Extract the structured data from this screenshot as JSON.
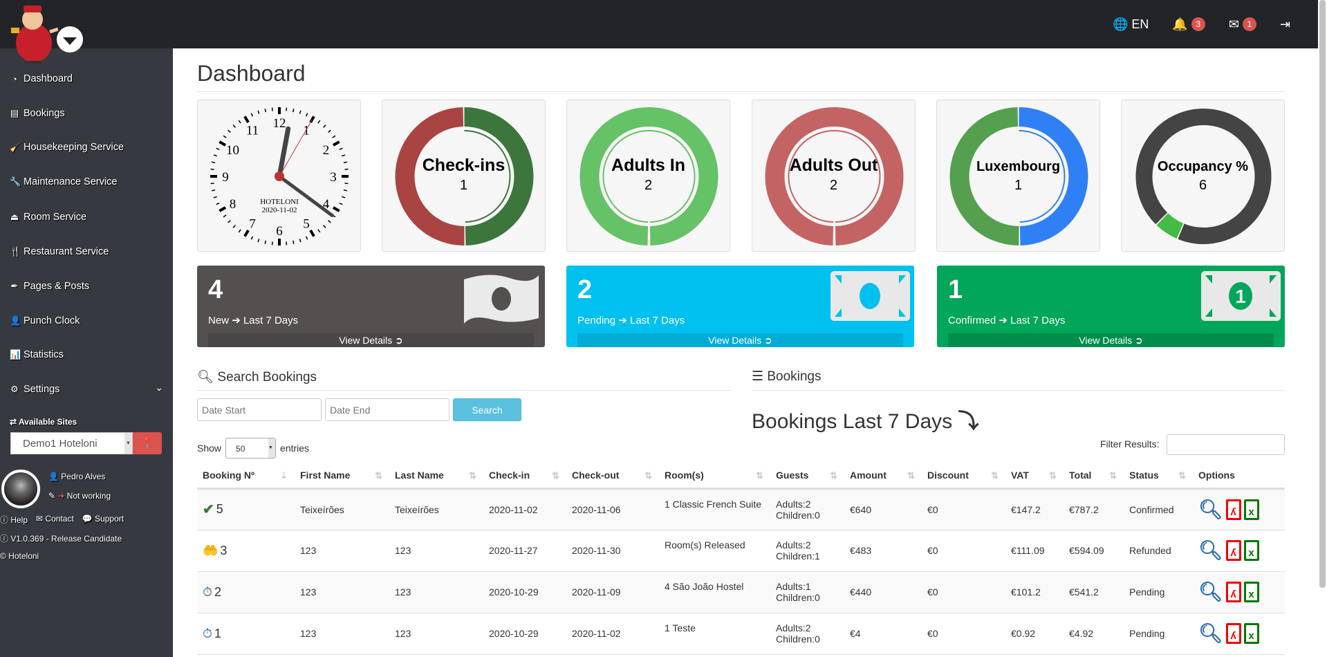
{
  "topbar": {
    "language": "EN",
    "notifications_count": "3",
    "messages_count": "1",
    "icons": [
      "globe-icon",
      "bell-icon",
      "envelope-icon",
      "sign-out-icon"
    ]
  },
  "sidebar": {
    "items": [
      {
        "label": "Dashboard",
        "icon": "dashboard-icon"
      },
      {
        "label": "Bookings",
        "icon": "list-alt-icon"
      },
      {
        "label": "Housekeeping Service",
        "icon": "broom-icon"
      },
      {
        "label": "Maintenance Service",
        "icon": "wrench-icon"
      },
      {
        "label": "Room Service",
        "icon": "bell-concierge-icon"
      },
      {
        "label": "Restaurant Service",
        "icon": "cutlery-icon"
      },
      {
        "label": "Pages & Posts",
        "icon": "pen-nib-icon"
      },
      {
        "label": "Punch Clock",
        "icon": "user-clock-icon"
      },
      {
        "label": "Statistics",
        "icon": "bar-chart-icon"
      },
      {
        "label": "Settings",
        "icon": "gear-icon"
      }
    ],
    "sites_label": "Available Sites",
    "site_selected": "Demo1 Hoteloni",
    "user_name": "Pedro Alves",
    "user_status": "Not working",
    "links": [
      "Help",
      "Contact",
      "Support"
    ],
    "version": "V1.0.369 - Release Candidate",
    "brand": "Hoteloni"
  },
  "page_title": "Dashboard",
  "clock": {
    "brand": "HOTELONI",
    "date": "2020-11-02",
    "time": "12:21:05"
  },
  "donuts": [
    {
      "label": "Check-ins",
      "value": "1",
      "segments": [
        {
          "color": "#3c763d",
          "share": 0.5
        },
        {
          "color": "#a94442",
          "share": 0.5
        }
      ]
    },
    {
      "label": "Adults In",
      "value": "2",
      "segments": [
        {
          "color": "#66c266",
          "share": 1
        }
      ]
    },
    {
      "label": "Adults Out",
      "value": "2",
      "segments": [
        {
          "color": "#c46363",
          "share": 1
        }
      ]
    },
    {
      "label": "Luxembourg",
      "value": "1",
      "segments": [
        {
          "color": "#2f80f5",
          "share": 0.5
        },
        {
          "color": "#55a04f",
          "share": 0.5
        }
      ]
    },
    {
      "label": "Occupancy %",
      "value": "6",
      "segments": [
        {
          "color": "#444444",
          "share": 0.94
        },
        {
          "color": "#44bb44",
          "share": 0.06
        }
      ]
    }
  ],
  "panels": [
    {
      "count": "4",
      "status": "New",
      "period": "Last 7 Days",
      "link": "View Details",
      "color": "#545050",
      "bar": "#4a4646"
    },
    {
      "count": "2",
      "status": "Pending",
      "period": "Last 7 Days",
      "link": "View Details",
      "color": "#00c0ef",
      "bar": "#00acd6"
    },
    {
      "count": "1",
      "status": "Confirmed",
      "period": "Last 7 Days",
      "link": "View Details",
      "color": "#00a65a",
      "bar": "#008d4c"
    }
  ],
  "search": {
    "title": "Search Bookings",
    "date_start_placeholder": "Date Start",
    "date_end_placeholder": "Date End",
    "button": "Search"
  },
  "bookings": {
    "title": "Bookings",
    "subtitle": "Bookings Last 7 Days",
    "show_label": "Show",
    "entries_label": "entries",
    "page_size": "50",
    "filter_label": "Filter Results:"
  },
  "table": {
    "columns": [
      "Booking Nº",
      "First Name",
      "Last Name",
      "Check-in",
      "Check-out",
      "Room(s)",
      "Guests",
      "Amount",
      "Discount",
      "VAT",
      "Total",
      "Status",
      "Options"
    ],
    "rows": [
      {
        "icon": "check-icon",
        "no": "5",
        "first": "Teixeírões",
        "last": "Teixeírões",
        "checkin": "2020-11-02",
        "checkout": "2020-11-06",
        "rooms": "1 Classic French Suite",
        "adults": "Adults:2",
        "children": "Children:0",
        "amount": "€640",
        "discount": "€0",
        "vat": "€147.2",
        "total": "€787.2",
        "status": "Confirmed"
      },
      {
        "icon": "refund-hand-icon",
        "no": "3",
        "first": "123",
        "last": "123",
        "checkin": "2020-11-27",
        "checkout": "2020-11-30",
        "rooms": "Room(s) Released",
        "adults": "Adults:2",
        "children": "Children:1",
        "amount": "€483",
        "discount": "€0",
        "vat": "€111.09",
        "total": "€594.09",
        "status": "Refunded"
      },
      {
        "icon": "stopwatch-icon",
        "no": "2",
        "first": "123",
        "last": "123",
        "checkin": "2020-10-29",
        "checkout": "2020-11-09",
        "rooms": "4 São João Hostel",
        "adults": "Adults:1",
        "children": "Children:0",
        "amount": "€440",
        "discount": "€0",
        "vat": "€101.2",
        "total": "€541.2",
        "status": "Pending"
      },
      {
        "icon": "stopwatch-icon",
        "no": "1",
        "first": "123",
        "last": "123",
        "checkin": "2020-10-29",
        "checkout": "2020-11-02",
        "rooms": "1 Teste",
        "adults": "Adults:2",
        "children": "Children:0",
        "amount": "€4",
        "discount": "€0",
        "vat": "€0.92",
        "total": "€4.92",
        "status": "Pending"
      }
    ]
  }
}
